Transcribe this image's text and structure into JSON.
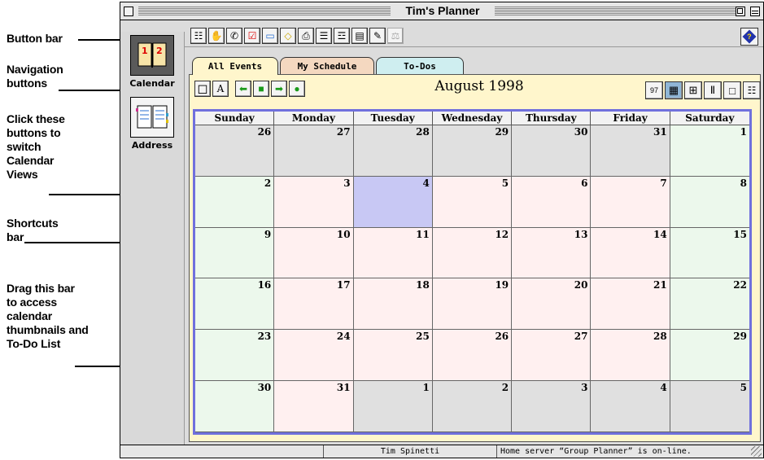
{
  "annotations": [
    {
      "id": "button-bar",
      "text": "Button bar"
    },
    {
      "id": "navigation-buttons",
      "text": "Navigation\nbuttons"
    },
    {
      "id": "switch-views",
      "text": "Click these\nbuttons to\nswitch\nCalendar\nViews"
    },
    {
      "id": "shortcuts-bar",
      "text": "Shortcuts\nbar"
    },
    {
      "id": "drag-bar",
      "text": "Drag this bar\nto access\ncalendar\nthumbnails and\nTo-Do List"
    }
  ],
  "window": {
    "title": "Tim's Planner"
  },
  "toolbar": {
    "buttons": [
      {
        "name": "contact-icon",
        "glyph": "☷"
      },
      {
        "name": "handshake-icon",
        "glyph": "✋"
      },
      {
        "name": "phone-call-icon",
        "glyph": "✆"
      },
      {
        "name": "todo-check-icon",
        "glyph": "☑"
      },
      {
        "name": "banner-event-icon",
        "glyph": "▭"
      },
      {
        "name": "note-icon",
        "glyph": "◇"
      },
      {
        "name": "print-icon",
        "glyph": "⎙"
      },
      {
        "name": "list-view-icon",
        "glyph": "☰"
      },
      {
        "name": "details-icon",
        "glyph": "☲"
      },
      {
        "name": "save-icon",
        "glyph": "▤"
      },
      {
        "name": "tools-icon",
        "glyph": "✎"
      },
      {
        "name": "scale-icon",
        "glyph": "⚖"
      }
    ],
    "help_icon": "help-icon"
  },
  "shortcuts": [
    {
      "label": "Calendar",
      "icon": "calendar-book-icon",
      "selected": true
    },
    {
      "label": "Address",
      "icon": "address-book-icon",
      "selected": false
    }
  ],
  "tabs": [
    {
      "label": "All Events",
      "color": "#fff6cc",
      "active": true
    },
    {
      "label": "My Schedule",
      "color": "#f4d8c0",
      "active": false
    },
    {
      "label": "To-Dos",
      "color": "#cfeef0",
      "active": false
    }
  ],
  "calendar": {
    "month_label": "August 1998",
    "nav_buttons": [
      {
        "name": "new-event-icon",
        "glyph": "◻"
      },
      {
        "name": "text-style-icon",
        "glyph": "A"
      },
      {
        "name": "prev-arrow-icon",
        "glyph": "⬅"
      },
      {
        "name": "today-square-icon",
        "glyph": "■"
      },
      {
        "name": "next-arrow-icon",
        "glyph": "➡"
      },
      {
        "name": "dot-icon",
        "glyph": "●"
      }
    ],
    "view_buttons": [
      {
        "name": "day-view-icon",
        "glyph": "97",
        "active": false
      },
      {
        "name": "month-view-icon",
        "glyph": "▦",
        "active": true
      },
      {
        "name": "week-grid-view-icon",
        "glyph": "⊞",
        "active": false
      },
      {
        "name": "week-columns-view-icon",
        "glyph": "Ⅱ",
        "active": false
      },
      {
        "name": "blank-view-icon",
        "glyph": "□",
        "active": false
      },
      {
        "name": "list-view-icon",
        "glyph": "☷",
        "active": false
      }
    ],
    "day_names": [
      "Sunday",
      "Monday",
      "Tuesday",
      "Wednesday",
      "Thursday",
      "Friday",
      "Saturday"
    ],
    "weeks": [
      [
        "26",
        "27",
        "28",
        "29",
        "30",
        "31",
        "1"
      ],
      [
        "2",
        "3",
        "4",
        "5",
        "6",
        "7",
        "8"
      ],
      [
        "9",
        "10",
        "11",
        "12",
        "13",
        "14",
        "15"
      ],
      [
        "16",
        "17",
        "18",
        "19",
        "20",
        "21",
        "22"
      ],
      [
        "23",
        "24",
        "25",
        "26",
        "27",
        "28",
        "29"
      ],
      [
        "30",
        "31",
        "1",
        "2",
        "3",
        "4",
        "5"
      ]
    ],
    "today": "4"
  },
  "status": {
    "user": "Tim Spinetti",
    "server": "Home server “Group Planner” is on-line."
  }
}
